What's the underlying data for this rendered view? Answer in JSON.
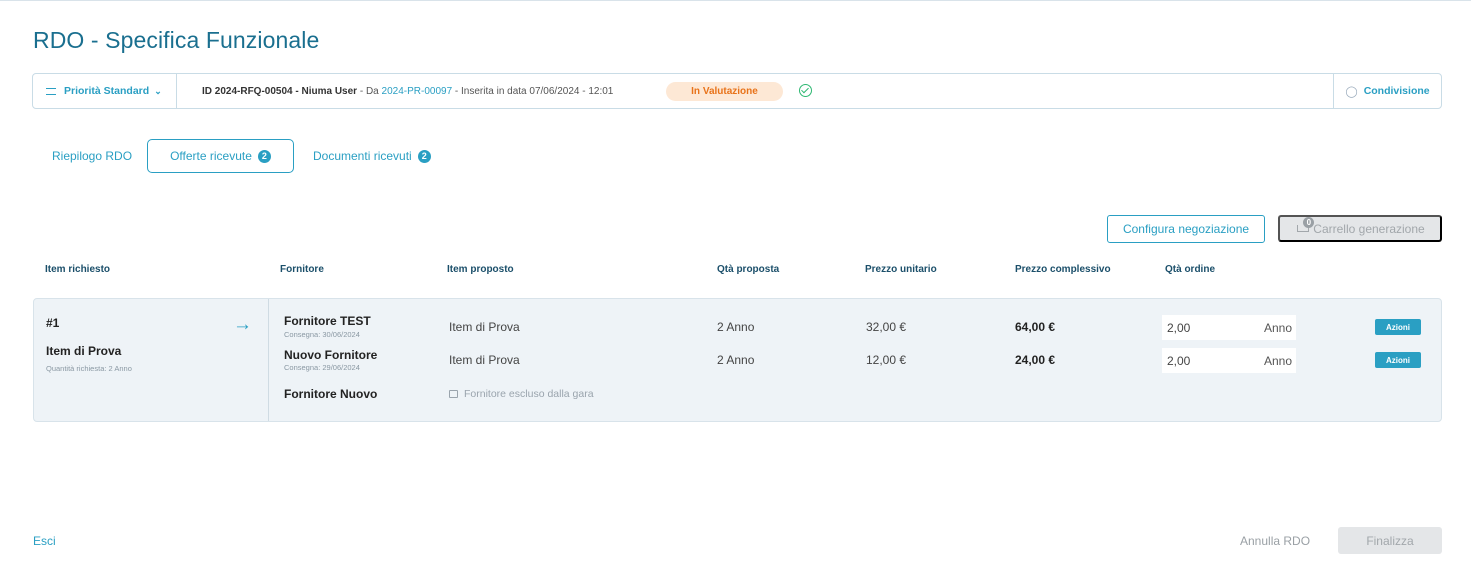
{
  "page": {
    "title": "RDO - Specifica Funzionale"
  },
  "infobar": {
    "priority": "Priorità Standard",
    "id_text": "ID 2024-RFQ-00504 - Niuma User",
    "from_prefix": " - Da ",
    "from_link": "2024-PR-00097",
    "inserted": " - Inserita in data 07/06/2024 - 12:01",
    "status": "In Valutazione",
    "share": "Condivisione",
    "colors": {
      "accent": "#2a9fc3",
      "status_bg": "#fde8d5",
      "status_fg": "#e8731a",
      "check": "#2eb872"
    }
  },
  "tabs": [
    {
      "label": "Riepilogo RDO",
      "active": false
    },
    {
      "label": "Offerte ricevute",
      "badge": "2",
      "active": true
    },
    {
      "label": "Documenti ricevuti",
      "badge": "2",
      "active": false
    }
  ],
  "actions": {
    "configure": "Configura negoziazione",
    "cart": "Carrello generazione",
    "cart_count": "0"
  },
  "table": {
    "headers": [
      "Item richiesto",
      "Fornitore",
      "Item proposto",
      "Qtà proposta",
      "Prezzo unitario",
      "Prezzo complessivo",
      "Qtà ordine"
    ],
    "requested": {
      "number": "#1",
      "name": "Item di Prova",
      "qty": "Quantità richiesta: 2 Anno"
    },
    "rows": [
      {
        "supplier": "Fornitore TEST",
        "delivery": "Consegna: 30/06/2024",
        "item": "Item di Prova",
        "qty": "2 Anno",
        "unit_price": "32,00 €",
        "total": "64,00 €",
        "order_qty": "2,00",
        "order_unit": "Anno",
        "action": "Azioni"
      },
      {
        "supplier": "Nuovo Fornitore",
        "delivery": "Consegna: 29/06/2024",
        "item": "Item di Prova",
        "qty": "2 Anno",
        "unit_price": "12,00 €",
        "total": "24,00 €",
        "order_qty": "2,00",
        "order_unit": "Anno",
        "action": "Azioni"
      }
    ],
    "excluded": {
      "supplier": "Fornitore Nuovo",
      "note": "Fornitore escluso dalla gara"
    }
  },
  "footer": {
    "exit": "Esci",
    "cancel": "Annulla RDO",
    "finalize": "Finalizza"
  }
}
